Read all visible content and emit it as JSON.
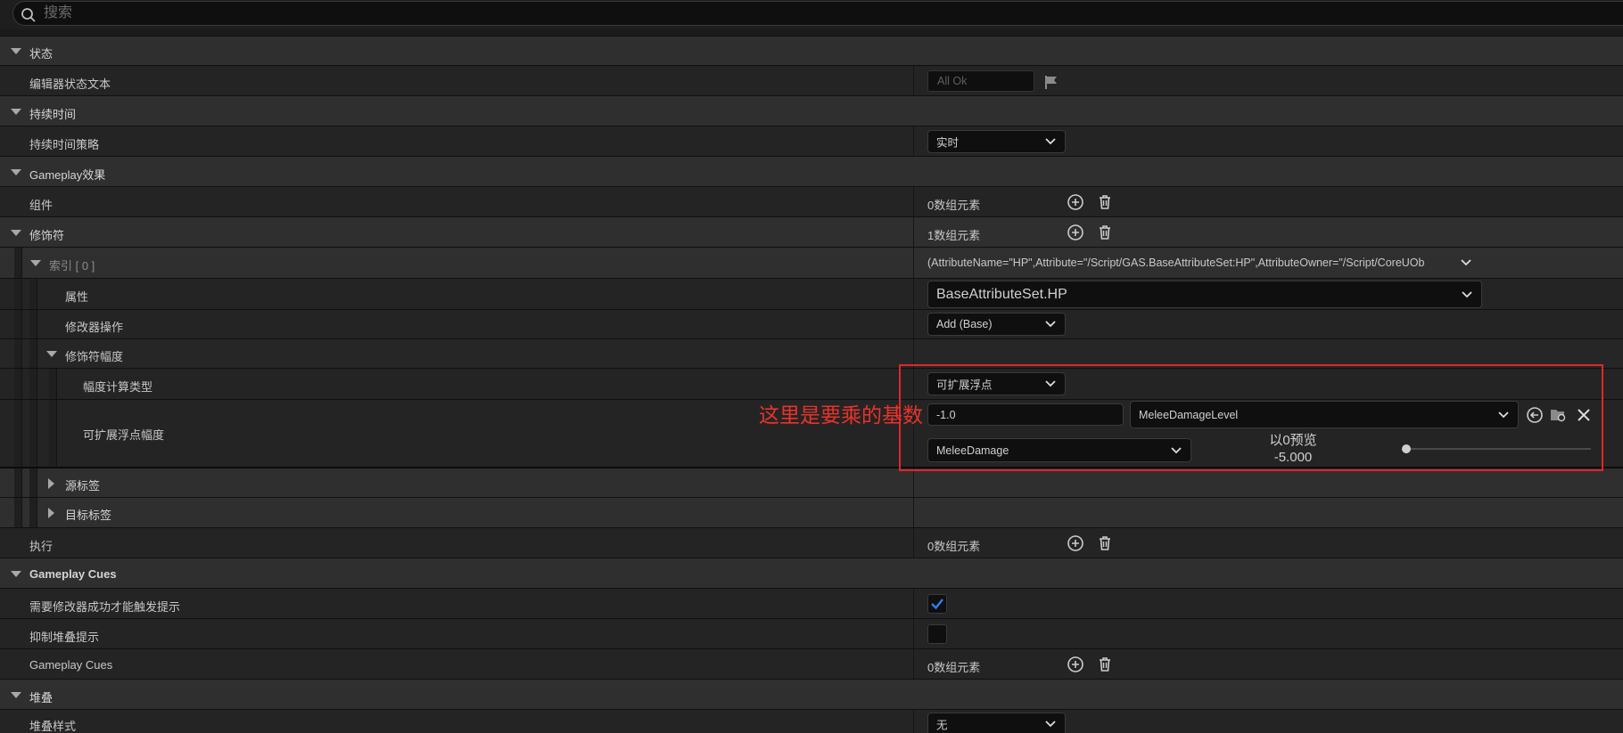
{
  "search": {
    "placeholder": "搜索"
  },
  "sections": {
    "status": {
      "label": "状态",
      "editor_status_label": "编辑器状态文本",
      "editor_status_value": "All Ok"
    },
    "duration": {
      "label": "持续时间",
      "policy_label": "持续时间策略",
      "policy_value": "实时"
    },
    "gameplay_effect": {
      "label": "Gameplay效果",
      "components_label": "组件",
      "components_value": "0数组元素"
    },
    "modifiers": {
      "label": "修饰符",
      "value": "1数组元素",
      "index_label": "索引 [ 0 ]",
      "index_value": "(AttributeName=\"HP\",Attribute=\"/Script/GAS.BaseAttributeSet:HP\",AttributeOwner=\"/Script/CoreUOb",
      "attribute_label": "属性",
      "attribute_value": "BaseAttributeSet.HP",
      "op_label": "修改器操作",
      "op_value": "Add (Base)",
      "magnitude_label": "修饰符幅度",
      "calc_type_label": "幅度计算类型",
      "calc_type_value": "可扩展浮点",
      "scalable_label": "可扩展浮点幅度",
      "scalable_value": "-1.0",
      "curve_table": "MeleeDamageLevel",
      "curve_row": "MeleeDamage",
      "preview_label": "以0预览",
      "preview_value": "-5.000",
      "source_tags_label": "源标签",
      "target_tags_label": "目标标签"
    },
    "executions": {
      "label": "执行",
      "value": "0数组元素"
    },
    "gameplay_cues": {
      "label": "Gameplay Cues",
      "require_success_label": "需要修改器成功才能触发提示",
      "require_success_checked": true,
      "suppress_stacking_label": "抑制堆叠提示",
      "suppress_stacking_checked": false,
      "cues_label": "Gameplay Cues",
      "cues_value": "0数组元素"
    },
    "stacking": {
      "label": "堆叠",
      "type_label": "堆叠样式",
      "type_value": "无"
    }
  },
  "annotation": {
    "text": "这里是要乘的基数",
    "color": "#e8332b"
  },
  "colors": {
    "accent": "#2f7ef0",
    "panel": "#242424",
    "category": "#2f2f2f"
  }
}
